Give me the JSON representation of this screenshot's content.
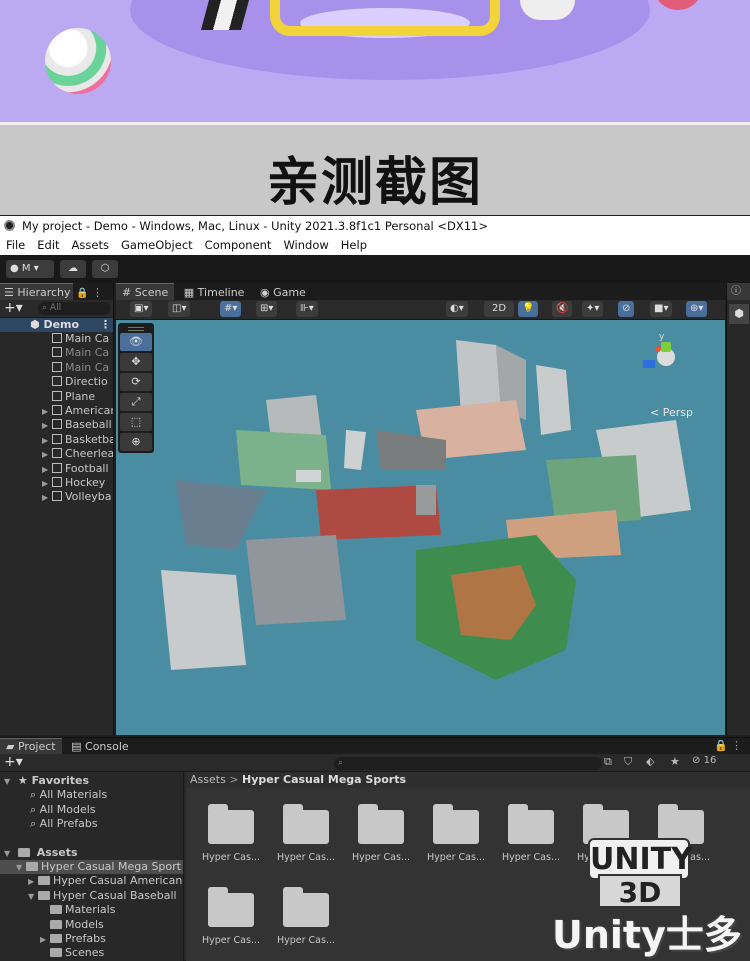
{
  "caption": "亲测截图",
  "window": {
    "title": "My project - Demo - Windows, Mac, Linux - Unity 2021.3.8f1c1 Personal <DX11>"
  },
  "menu": [
    "File",
    "Edit",
    "Assets",
    "GameObject",
    "Component",
    "Window",
    "Help"
  ],
  "toolbar": {
    "account_label": "M"
  },
  "hierarchy": {
    "tab_label": "Hierarchy",
    "search_placeholder": "All",
    "scene_name": "Demo",
    "items": [
      {
        "label": "Main Ca",
        "dim": false,
        "expandable": false
      },
      {
        "label": "Main Ca",
        "dim": true,
        "expandable": false
      },
      {
        "label": "Main Ca",
        "dim": true,
        "expandable": false
      },
      {
        "label": "Directio",
        "dim": false,
        "expandable": false
      },
      {
        "label": "Plane",
        "dim": false,
        "expandable": false
      },
      {
        "label": "American",
        "dim": false,
        "expandable": true
      },
      {
        "label": "Baseball",
        "dim": false,
        "expandable": true
      },
      {
        "label": "Basketba",
        "dim": false,
        "expandable": true
      },
      {
        "label": "Cheerlea",
        "dim": false,
        "expandable": true
      },
      {
        "label": "Football",
        "dim": false,
        "expandable": true
      },
      {
        "label": "Hockey",
        "dim": false,
        "expandable": true
      },
      {
        "label": "Volleyba",
        "dim": false,
        "expandable": true
      }
    ]
  },
  "scene_view": {
    "tabs": [
      "Scene",
      "Timeline",
      "Game"
    ],
    "mode_2d": "2D",
    "projection_label": "< Persp",
    "gizmo_axis_label": "y"
  },
  "project": {
    "tabs": [
      "Project",
      "Console"
    ],
    "hidden_count": "16",
    "favorites_label": "Favorites",
    "favorites": [
      "All Materials",
      "All Models",
      "All Prefabs"
    ],
    "assets_label": "Assets",
    "assets_tree": [
      {
        "label": "Hyper Casual Mega Sport",
        "depth": 1,
        "selected": true
      },
      {
        "label": "Hyper Casual American",
        "depth": 2
      },
      {
        "label": "Hyper Casual Baseball",
        "depth": 2
      },
      {
        "label": "Materials",
        "depth": 3
      },
      {
        "label": "Models",
        "depth": 3
      },
      {
        "label": "Prefabs",
        "depth": 3
      },
      {
        "label": "Scenes",
        "depth": 3
      }
    ],
    "breadcrumb": [
      "Assets",
      "Hyper Casual Mega Sports"
    ],
    "grid_folders": [
      "Hyper Cas...",
      "Hyper Cas...",
      "Hyper Cas...",
      "Hyper Cas...",
      "Hyper Cas...",
      "Hyper Cas...",
      "Hyper Cas...",
      "Hyper Cas...",
      "Hyper Cas..."
    ]
  },
  "watermark": {
    "line1": "UNITY",
    "line2": "3D",
    "line3": "Unity士多"
  },
  "colors": {
    "banner_bg": "#bba9f2",
    "viewport_bg": "#4a8da2",
    "editor_bg": "#282828",
    "accent_blue": "#4a6f9a"
  }
}
